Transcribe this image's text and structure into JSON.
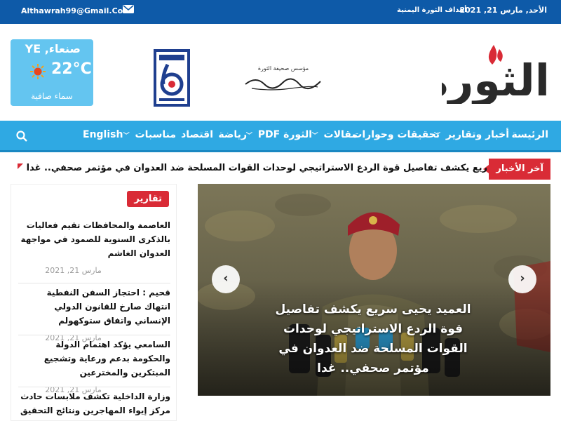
{
  "topbar": {
    "email": "Althawrah99@Gmail.Com",
    "date": "الأحد, مارس 21, 2021",
    "goals_link": "أهداف الثورة اليمنية"
  },
  "weather": {
    "city": "صنعاء, YE",
    "temperature": "22°C",
    "condition": "سماء صافية",
    "icon": "sun-icon"
  },
  "branding": {
    "logo_text": "الثورة",
    "signature_line1": "مؤسس صحيفة الثورة",
    "signature_name": "عبدالرحمن عبدالله الارضي",
    "badge_number": "6"
  },
  "nav": {
    "items": [
      {
        "label": "الرئيسة",
        "dropdown": false
      },
      {
        "label": "أخبار وتقارير",
        "dropdown": true
      },
      {
        "label": "تحقيقات وحوارات",
        "dropdown": false
      },
      {
        "label": "مقالات",
        "dropdown": true
      },
      {
        "label": "الثورة PDF",
        "dropdown": true
      },
      {
        "label": "رياضة",
        "dropdown": false
      },
      {
        "label": "اقتصاد",
        "dropdown": false
      },
      {
        "label": "مناسبات",
        "dropdown": true
      },
      {
        "label": "English",
        "dropdown": false
      }
    ]
  },
  "ticker": {
    "label": "آخر الأخبار",
    "headline": "ريع يكشف تفاصيل قوة الردع الاستراتيجي لوحدات القوات المسلحة ضد العدوان في مؤتمر صحفي.. غدا"
  },
  "sidebar": {
    "section_label": "تقارير",
    "posts": [
      {
        "title": "العاصمة والمحافظات تقيم فعاليات بالذكرى السنوية للصمود في مواجهة العدوان الغاشم",
        "date": "مارس 21, 2021"
      },
      {
        "title": "قحيم : احتجاز السفن النفطية انتهاك صارخ للقانون الدولي الإنساني واتفاق ستوكهولم",
        "date": "مارس 21, 2021"
      },
      {
        "title": "السامعي يؤكد اهتمام الدولة والحكومة بدعم ورعاية وتشجيع المبتكرين والمخترعين",
        "date": "مارس 21, 2021"
      },
      {
        "title": "وزارة الداخلية تكشف ملابسات حادث مركز إيواء المهاجرين ونتائج التحقيق",
        "date": ""
      }
    ]
  },
  "slider": {
    "caption": "العميد يحيى سريع يكشف تفاصيل قوة الردع الاستراتيجي لوحدات القوات المسلحة ضد العدوان في مؤتمر صحفي.. غدا",
    "prev_icon": "chevron-left-icon",
    "next_icon": "chevron-right-icon"
  },
  "colors": {
    "topbar": "#0e5aa8",
    "nav": "#2fa9e3",
    "accent_red": "#d92b36",
    "weather_bg": "#64c5f0"
  }
}
